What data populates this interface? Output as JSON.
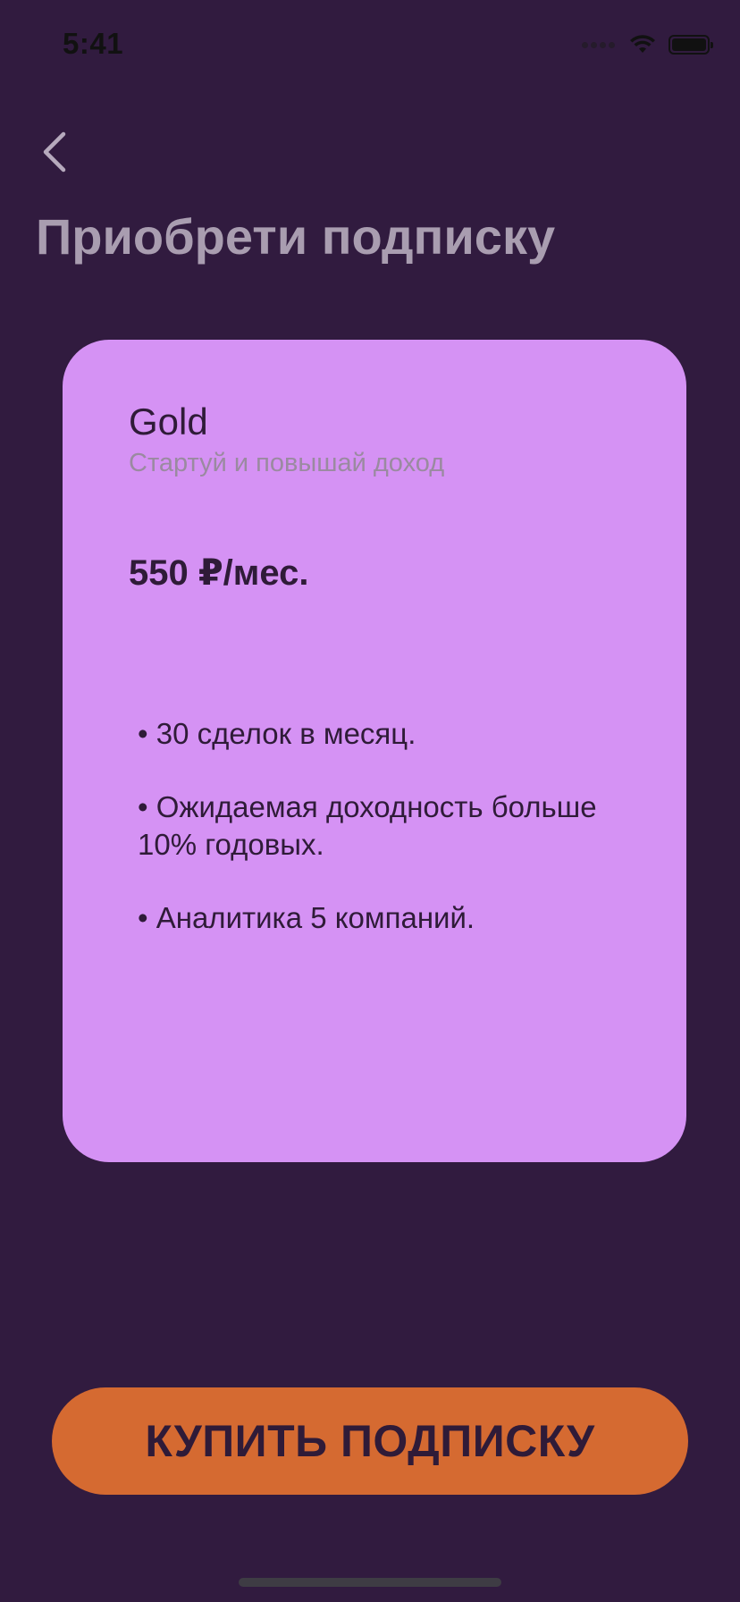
{
  "status_bar": {
    "time": "5:41",
    "icons": [
      "signal-icon",
      "wifi-icon",
      "battery-icon"
    ]
  },
  "header": {
    "back_icon": "chevron-left-icon",
    "title": "Приобрети подписку"
  },
  "plan": {
    "name": "Gold",
    "tagline": "Стартуй и повышай доход",
    "price": "550 ₽/мес.",
    "features": [
      "• 30 сделок в месяц.",
      "• Ожидаемая доходность больше 10% годовых.",
      "• Аналитика 5 компаний."
    ]
  },
  "actions": {
    "buy_label": "КУПИТЬ ПОДПИСКУ"
  },
  "colors": {
    "background": "#311B3F",
    "card": "#D592F4",
    "button": "#D56A31",
    "title": "#A99DB0",
    "text_dark": "#2F1B38",
    "tagline": "#9A8AA0"
  }
}
